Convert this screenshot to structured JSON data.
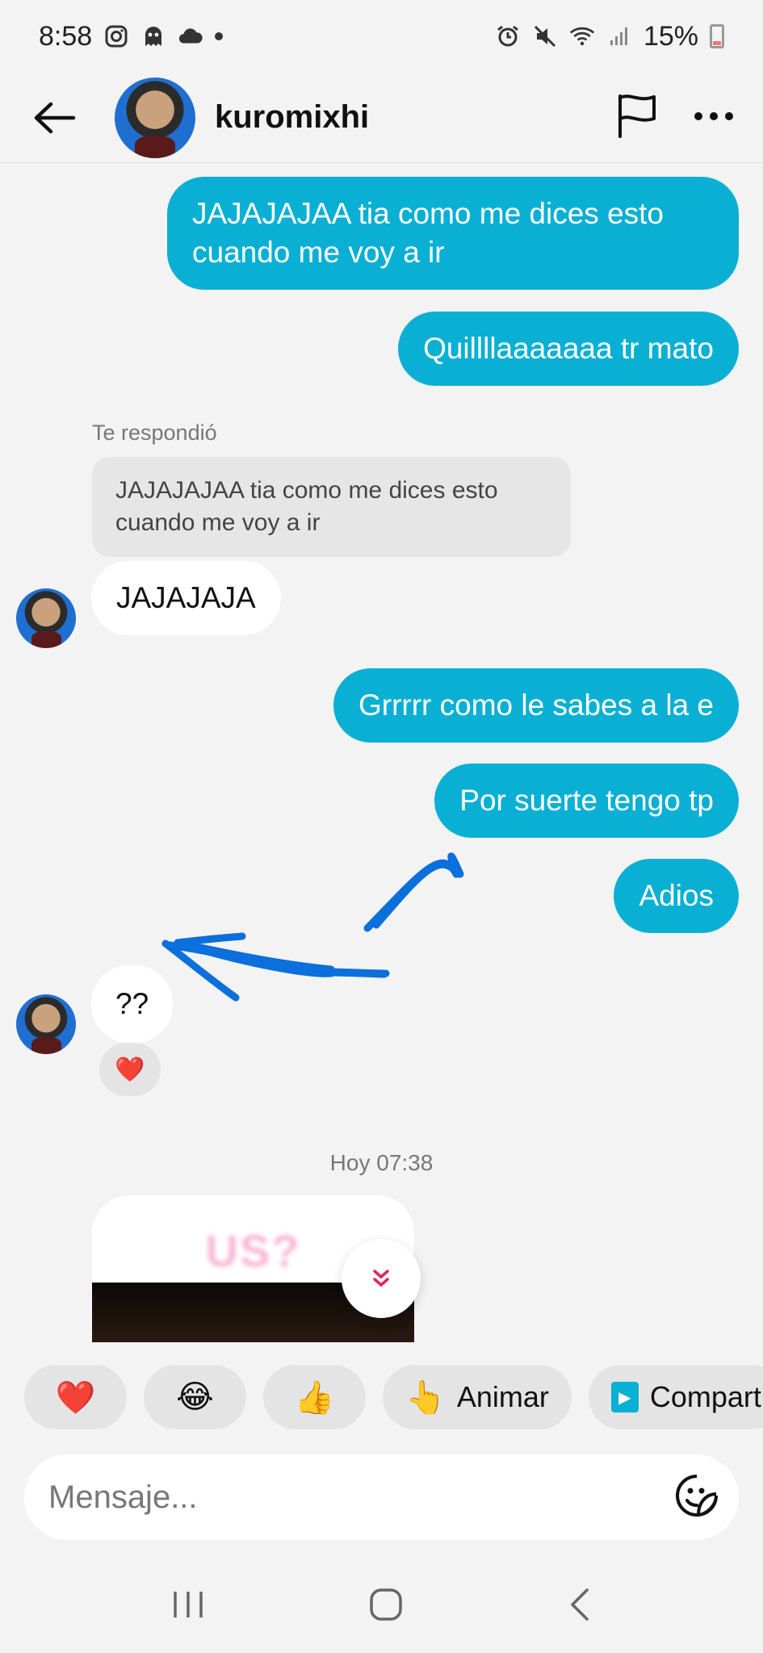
{
  "status_bar": {
    "time": "8:58",
    "battery": "15%"
  },
  "header": {
    "username": "kuromixhi"
  },
  "chat": {
    "messages_out_top": [
      "JAJAJAJAA tia como me dices esto cuando me voy a ir",
      "Quillllaaaaaaa tr mato"
    ],
    "reply_label": "Te respondió",
    "reply_quote": "JAJAJAJAA tia como me dices esto cuando me voy a ir",
    "incoming_1": "JAJAJAJA",
    "messages_out_bottom": [
      "Grrrrr como le sabes a la e",
      "Por suerte tengo tp",
      "Adios"
    ],
    "incoming_2": "??",
    "reaction_emoji": "❤️",
    "timestamp": "Hoy 07:38",
    "media_preview_text": "US?"
  },
  "quick_reactions": [
    {
      "emoji": "❤️",
      "label": ""
    },
    {
      "emoji": "😂",
      "label": ""
    },
    {
      "emoji": "👍",
      "label": ""
    },
    {
      "emoji": "👆",
      "label": "Animar"
    },
    {
      "emoji": "▶",
      "label": "Compart"
    }
  ],
  "composer": {
    "placeholder": "Mensaje..."
  },
  "colors": {
    "outgoing_bubble": "#0ab0d4",
    "annotation_arrow": "#0b6fdc"
  },
  "icons": [
    "back-arrow-icon",
    "flag-icon",
    "more-icon",
    "sticker-icon",
    "chevron-down-icon",
    "recent-apps-icon",
    "home-icon",
    "nav-back-icon"
  ]
}
